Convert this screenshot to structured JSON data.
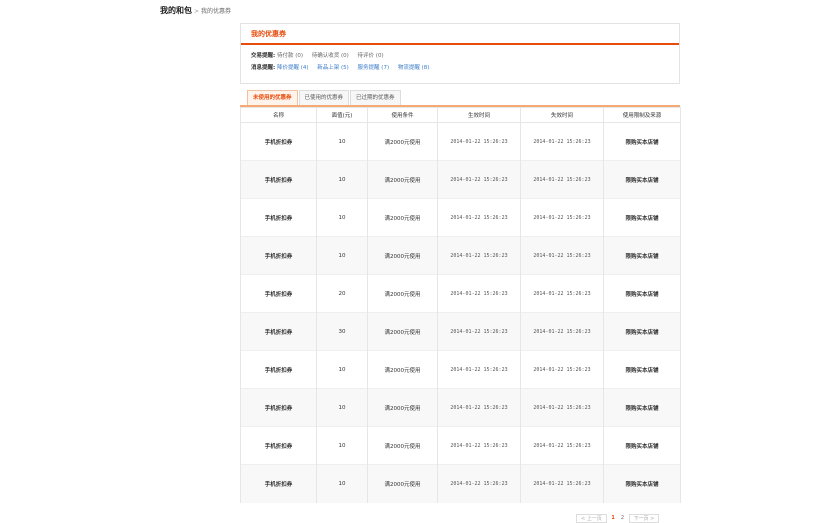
{
  "breadcrumb": {
    "root": "我的和包",
    "separator": ">",
    "current": "我的优惠券"
  },
  "panel": {
    "title": "我的优惠券",
    "trade_reminder": {
      "label": "交易提醒:",
      "items": [
        "待付款 (0)",
        "待确认收货 (0)",
        "待评价 (0)"
      ]
    },
    "message_reminder": {
      "label": "消息提醒:",
      "items": [
        "降价提醒 (4)",
        "新品上架 (5)",
        "服务提醒 (7)",
        "物流提醒 (8)"
      ]
    }
  },
  "tabs": [
    {
      "label": "未使用的优惠券",
      "active": true
    },
    {
      "label": "已使用的优惠券",
      "active": false
    },
    {
      "label": "已过期的优惠券",
      "active": false
    }
  ],
  "table": {
    "headers": [
      "名称",
      "面值(元)",
      "使用条件",
      "生效时间",
      "失效时间",
      "使用限制及来源"
    ],
    "rows": [
      [
        "手机折扣券",
        "10",
        "满2000元使用",
        "2014-01-22 15:26:23",
        "2014-01-22 15:26:23",
        "限购买本店铺"
      ],
      [
        "手机折扣券",
        "10",
        "满2000元使用",
        "2014-01-22 15:26:23",
        "2014-01-22 15:26:23",
        "限购买本店铺"
      ],
      [
        "手机折扣券",
        "10",
        "满2000元使用",
        "2014-01-22 15:26:23",
        "2014-01-22 15:26:23",
        "限购买本店铺"
      ],
      [
        "手机折扣券",
        "10",
        "满2000元使用",
        "2014-01-22 15:26:23",
        "2014-01-22 15:26:23",
        "限购买本店铺"
      ],
      [
        "手机折扣券",
        "20",
        "满2000元使用",
        "2014-01-22 15:26:23",
        "2014-01-22 15:26:23",
        "限购买本店铺"
      ],
      [
        "手机折扣券",
        "30",
        "满2000元使用",
        "2014-01-22 15:26:23",
        "2014-01-22 15:26:23",
        "限购买本店铺"
      ],
      [
        "手机折扣券",
        "10",
        "满2000元使用",
        "2014-01-22 15:26:23",
        "2014-01-22 15:26:23",
        "限购买本店铺"
      ],
      [
        "手机折扣券",
        "10",
        "满2000元使用",
        "2014-01-22 15:26:23",
        "2014-01-22 15:26:23",
        "限购买本店铺"
      ],
      [
        "手机折扣券",
        "10",
        "满2000元使用",
        "2014-01-22 15:26:23",
        "2014-01-22 15:26:23",
        "限购买本店铺"
      ],
      [
        "手机折扣券",
        "10",
        "满2000元使用",
        "2014-01-22 15:26:23",
        "2014-01-22 15:26:23",
        "限购买本店铺"
      ]
    ]
  },
  "pager": {
    "prev": "< 上一页",
    "pages": [
      "1",
      "2"
    ],
    "current_page": "1",
    "next": "下一页 >"
  },
  "colors": {
    "accent": "#e84c0c",
    "link": "#3a7cc9"
  }
}
